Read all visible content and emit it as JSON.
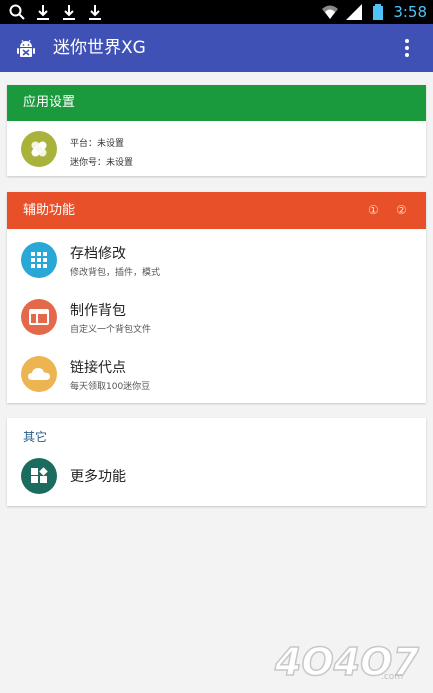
{
  "status_bar": {
    "time": "3:58",
    "icons": [
      "search-icon",
      "download-icon",
      "download-icon",
      "download-icon",
      "wifi-icon",
      "signal-icon",
      "battery-icon"
    ]
  },
  "app_bar": {
    "title": "迷你世界XG",
    "app_icon": "android-icon",
    "menu_icon": "more-vert-icon"
  },
  "app_settings": {
    "header": "应用设置",
    "header_color": "#1a9a3c",
    "icon": "bandage-icon",
    "icon_color": "#a9b23a",
    "platform_line": "平台：未设置",
    "mini_id_line": "迷你号：未设置"
  },
  "assist": {
    "header": "辅助功能",
    "header_color": "#e8502a",
    "header_badges": [
      "①",
      "②"
    ],
    "items": [
      {
        "title": "存档修改",
        "subtitle": "修改背包，插件，模式",
        "icon": "grid-icon",
        "color": "#29a8d8"
      },
      {
        "title": "制作背包",
        "subtitle": "自定义一个背包文件",
        "icon": "window-icon",
        "color": "#e4684a"
      },
      {
        "title": "链接代点",
        "subtitle": "每天领取100迷你豆",
        "icon": "cloud-icon",
        "color": "#edb552"
      }
    ]
  },
  "other": {
    "header": "其它",
    "item": {
      "title": "更多功能",
      "icon": "widgets-icon",
      "color": "#1c6b5f"
    }
  },
  "watermark": {
    "text": "4O4O7.com"
  }
}
